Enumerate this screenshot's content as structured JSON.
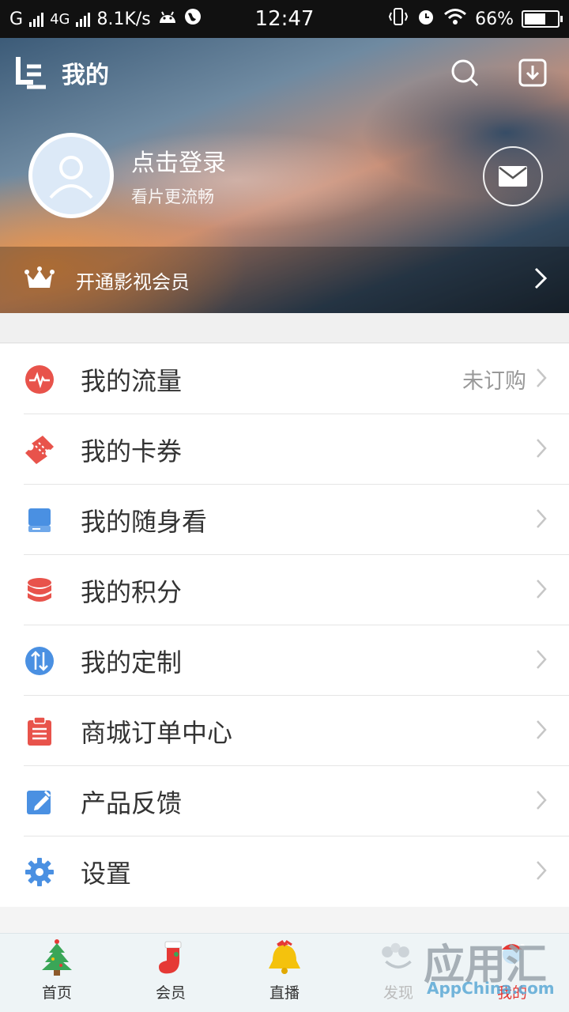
{
  "status_bar": {
    "carrier": "G",
    "network": "4G",
    "speed": "8.1K/s",
    "time": "12:47",
    "battery": "66%",
    "battery_level": 0.66
  },
  "header": {
    "title": "我的"
  },
  "profile": {
    "login_text": "点击登录",
    "subtitle": "看片更流畅"
  },
  "vip": {
    "label": "开通影视会员"
  },
  "menu": [
    {
      "label": "我的流量",
      "value": "未订购",
      "icon": "pulse-icon",
      "color": "#e8534b"
    },
    {
      "label": "我的卡券",
      "value": "",
      "icon": "ticket-icon",
      "color": "#e8534b"
    },
    {
      "label": "我的随身看",
      "value": "",
      "icon": "download-box-icon",
      "color": "#4a90e2"
    },
    {
      "label": "我的积分",
      "value": "",
      "icon": "coins-icon",
      "color": "#e8534b"
    },
    {
      "label": "我的定制",
      "value": "",
      "icon": "swap-icon",
      "color": "#4a90e2"
    },
    {
      "label": "商城订单中心",
      "value": "",
      "icon": "clipboard-icon",
      "color": "#e8534b"
    },
    {
      "label": "产品反馈",
      "value": "",
      "icon": "edit-icon",
      "color": "#4a90e2"
    },
    {
      "label": "设置",
      "value": "",
      "icon": "gear-icon",
      "color": "#4a90e2"
    }
  ],
  "bottom_nav": [
    {
      "label": "首页",
      "icon": "christmas-tree-icon"
    },
    {
      "label": "会员",
      "icon": "stocking-icon"
    },
    {
      "label": "直播",
      "icon": "bell-icon"
    },
    {
      "label": "发现",
      "icon": "discover-icon"
    },
    {
      "label": "我的",
      "icon": "profile-icon"
    }
  ],
  "watermark": {
    "title": "应用汇",
    "subtitle": "AppChina.com"
  },
  "colors": {
    "accent_red": "#e8534b",
    "accent_blue": "#4a90e2",
    "active_tab": "#e53935"
  }
}
